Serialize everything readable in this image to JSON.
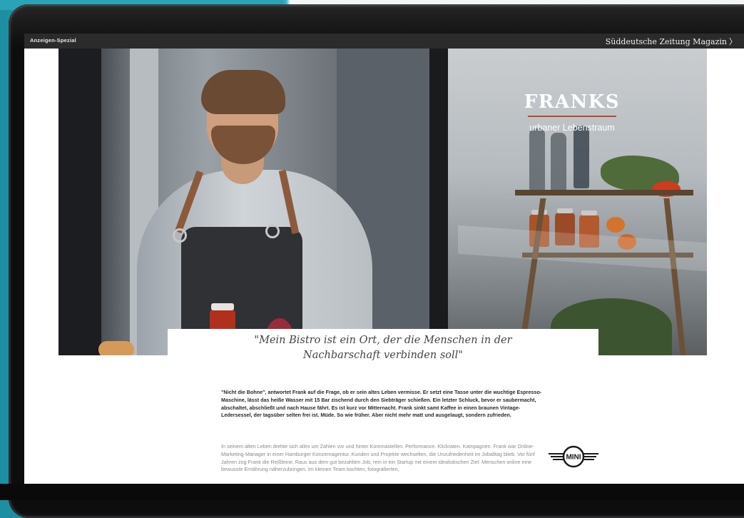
{
  "topbar": {
    "left_label": "Anzeigen-Spezial",
    "right_label": "Süddeutsche Zeitung Magazin",
    "chevron": "〉"
  },
  "hero": {
    "brand_name": "FRANKS",
    "brand_subtitle": "urbaner Lebenstraum"
  },
  "quote": {
    "line1": "\"Mein Bistro ist ein Ort, der die Menschen in der",
    "line2": "Nachbarschaft verbinden soll\""
  },
  "article": {
    "para_bold": "\"Nicht die Bohne\", antwortet Frank auf die Frage, ob er sein altes Leben vermisse. Er setzt eine Tasse unter die wuchtige Espresso-Maschine, lässt das heiße Wasser mit 15 Bar zischend durch den Siebträger schießen. Ein letzter Schluck, bevor er saubermacht, abschaltet, abschließt und nach Hause fährt. Es ist kurz vor Mitternacht. Frank sinkt samt Kaffee in einen braunen Vintage-Ledersessel, der tagsüber selten frei ist. Müde. So wie früher. Aber nicht mehr matt und ausgelaugt, sondern zufrieden.",
    "para_light": "In seinem alten Leben drehte sich alles um Zahlen vor und hinter Kommastellen. Performance. Klickraten. Kampagnen. Frank war Online-Marketing-Manager in einer Hamburger Konzernagentur. Kunden und Projekte wechselten, die Unzufriedenheit im Joballtag blieb. Vor fünf Jahren zog Frank die Reißleine. Raus aus dem gut bezahlten Job, rein in ein Startup mit einem idealistischen Ziel: Menschen online eine bewusste Ernährung näherzubringen. Im kleinen Team kochten, fotografierten,"
  },
  "sponsor": {
    "logo_text": "MINI",
    "icon": "mini-logo-icon"
  },
  "colors": {
    "backdrop": "#1e8fa3",
    "device": "#0d0d0e",
    "topbar": "#2b2b2b",
    "brand_rule": "#b84a2c"
  }
}
